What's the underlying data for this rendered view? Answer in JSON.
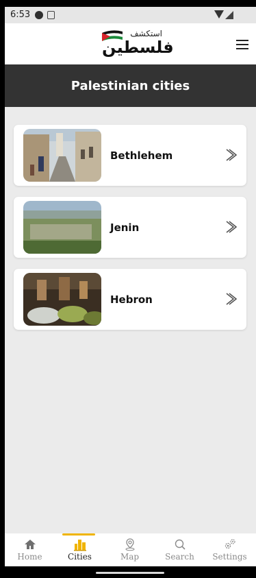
{
  "status_bar": {
    "time": "6:53"
  },
  "header": {
    "logo_small_text": "استكشف",
    "logo_big_text": "فلسطين",
    "menu_icon": "hamburger-menu-icon"
  },
  "page": {
    "title": "Palestinian cities"
  },
  "cities": [
    {
      "name": "Bethlehem"
    },
    {
      "name": "Jenin"
    },
    {
      "name": "Hebron"
    }
  ],
  "bottom_nav": {
    "active": "Cities",
    "active_color": "#f0b400",
    "items": [
      {
        "label": "Home",
        "icon": "home-icon"
      },
      {
        "label": "Cities",
        "icon": "city-icon"
      },
      {
        "label": "Map",
        "icon": "map-pin-icon"
      },
      {
        "label": "Search",
        "icon": "search-icon"
      },
      {
        "label": "Settings",
        "icon": "gear-icon"
      }
    ]
  },
  "colors": {
    "title_bar": "#333333",
    "background": "#ebebeb",
    "card": "#ffffff"
  }
}
